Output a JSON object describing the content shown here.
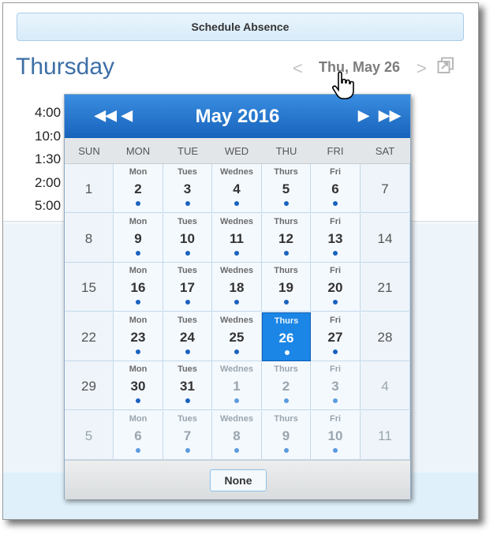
{
  "toolbar": {
    "schedule_label": "Schedule Absence"
  },
  "header": {
    "day_title": "Thursday",
    "date_label": "Thu, May 26",
    "prev": "<",
    "next": ">"
  },
  "times": [
    "4:00",
    "10:0",
    "1:30",
    "2:00",
    "5:00"
  ],
  "calendar": {
    "title": "May 2016",
    "nav": {
      "first": "◀◀",
      "prev": "◀",
      "next": "▶",
      "last": "▶▶"
    },
    "weekdays": [
      "SUN",
      "MON",
      "TUE",
      "WED",
      "THU",
      "FRI",
      "SAT"
    ],
    "weeks": [
      [
        {
          "n": "1"
        },
        {
          "n": "2",
          "w": "Mon",
          "dot": true
        },
        {
          "n": "3",
          "w": "Tues",
          "dot": true
        },
        {
          "n": "4",
          "w": "Wednes",
          "dot": true
        },
        {
          "n": "5",
          "w": "Thurs",
          "dot": true
        },
        {
          "n": "6",
          "w": "Fri",
          "dot": true
        },
        {
          "n": "7"
        }
      ],
      [
        {
          "n": "8"
        },
        {
          "n": "9",
          "w": "Mon",
          "dot": true
        },
        {
          "n": "10",
          "w": "Tues",
          "dot": true
        },
        {
          "n": "11",
          "w": "Wednes",
          "dot": true
        },
        {
          "n": "12",
          "w": "Thurs",
          "dot": true
        },
        {
          "n": "13",
          "w": "Fri",
          "dot": true
        },
        {
          "n": "14"
        }
      ],
      [
        {
          "n": "15"
        },
        {
          "n": "16",
          "w": "Mon",
          "dot": true
        },
        {
          "n": "17",
          "w": "Tues",
          "dot": true
        },
        {
          "n": "18",
          "w": "Wednes",
          "dot": true
        },
        {
          "n": "19",
          "w": "Thurs",
          "dot": true
        },
        {
          "n": "20",
          "w": "Fri",
          "dot": true
        },
        {
          "n": "21"
        }
      ],
      [
        {
          "n": "22"
        },
        {
          "n": "23",
          "w": "Mon",
          "dot": true
        },
        {
          "n": "24",
          "w": "Tues",
          "dot": true
        },
        {
          "n": "25",
          "w": "Wednes",
          "dot": true
        },
        {
          "n": "26",
          "w": "Thurs",
          "dot": true,
          "selected": true
        },
        {
          "n": "27",
          "w": "Fri",
          "dot": true
        },
        {
          "n": "28"
        }
      ],
      [
        {
          "n": "29"
        },
        {
          "n": "30",
          "w": "Mon",
          "dot": true
        },
        {
          "n": "31",
          "w": "Tues",
          "dot": true
        },
        {
          "n": "1",
          "w": "Wednes",
          "dot": true,
          "other": true
        },
        {
          "n": "2",
          "w": "Thurs",
          "dot": true,
          "other": true
        },
        {
          "n": "3",
          "w": "Fri",
          "dot": true,
          "other": true
        },
        {
          "n": "4",
          "other": true
        }
      ],
      [
        {
          "n": "5",
          "other": true
        },
        {
          "n": "6",
          "w": "Mon",
          "dot": true,
          "other": true
        },
        {
          "n": "7",
          "w": "Tues",
          "dot": true,
          "other": true
        },
        {
          "n": "8",
          "w": "Wednes",
          "dot": true,
          "other": true
        },
        {
          "n": "9",
          "w": "Thurs",
          "dot": true,
          "other": true
        },
        {
          "n": "10",
          "w": "Fri",
          "dot": true,
          "other": true
        },
        {
          "n": "11",
          "other": true
        }
      ]
    ],
    "none_label": "None"
  },
  "colors": {
    "accent": "#1b86e6",
    "header": "#1763bc",
    "title": "#3d6fa6"
  }
}
